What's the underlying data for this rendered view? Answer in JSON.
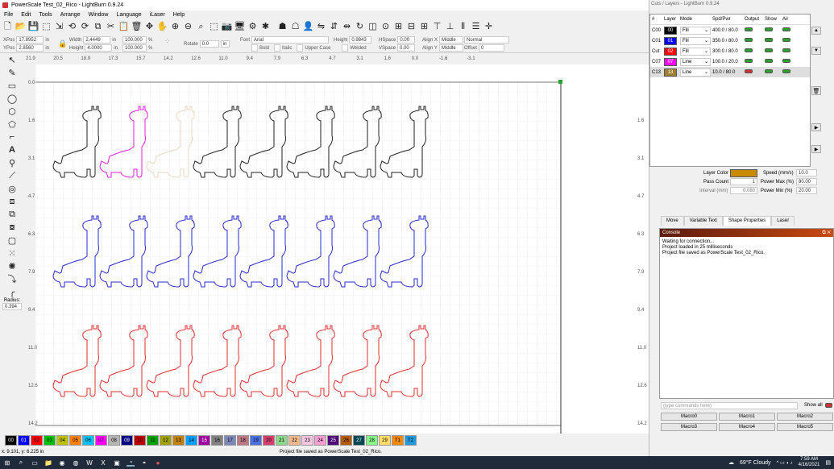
{
  "window": {
    "title": "PowerScale Test_02_Rico - LightBurn 0.9.24"
  },
  "menu": [
    "File",
    "Edit",
    "Tools",
    "Arrange",
    "Window",
    "Language",
    "iLaser",
    "Help"
  ],
  "props": {
    "xpos_label": "XPos",
    "xpos": "17.8952",
    "ypos_label": "YPos",
    "ypos": "2.8560",
    "unit": "in",
    "width_label": "Width",
    "width": "2.4449",
    "height_label": "Height",
    "height": "4.0000",
    "scale_w": "100.000",
    "scale_h": "100.000",
    "pct": "%",
    "rotate_label": "Rotate",
    "rotate": "0.0",
    "font_label": "Font",
    "font": "Arial",
    "fheight_label": "Height",
    "fheight": "0.9843",
    "hspace_label": "HSpace",
    "hspace": "0.00",
    "vspace_label": "VSpace",
    "vspace": "0.00",
    "alignx_label": "Align X",
    "alignx": "Middle",
    "aligny_label": "Align Y",
    "aligny": "Middle",
    "normal": "Normal",
    "offset_label": "Offset",
    "offset": "0",
    "bold": "Bold",
    "italic": "Italic",
    "upper": "Upper Case",
    "welded": "Welded"
  },
  "ruler_top": [
    "21.9",
    "20.5",
    "18.9",
    "17.3",
    "15.7",
    "14.2",
    "12.6",
    "11.0",
    "9.4",
    "7.9",
    "6.3",
    "4.7",
    "3.1",
    "1.6",
    "0.0",
    "-1.6",
    "-3.1"
  ],
  "ruler_left": [
    "0.0",
    "1.6",
    "3.1",
    "4.7",
    "6.3",
    "7.9",
    "9.4",
    "11.0",
    "12.6",
    "14.2"
  ],
  "ruler_right": [
    "1.6",
    "3.1",
    "4.7",
    "6.3",
    "7.9",
    "9.4",
    "11.0",
    "12.6",
    "14.2"
  ],
  "radius_label": "Radius:",
  "radius": "0.394",
  "palette": [
    {
      "id": "00",
      "color": "#000000",
      "text": "#ffffff"
    },
    {
      "id": "01",
      "color": "#0000ff",
      "text": "#ffffff"
    },
    {
      "id": "02",
      "color": "#ff0000",
      "text": "#000000"
    },
    {
      "id": "03",
      "color": "#00c000",
      "text": "#000000"
    },
    {
      "id": "04",
      "color": "#c0c000",
      "text": "#000000"
    },
    {
      "id": "05",
      "color": "#ff8000",
      "text": "#000000"
    },
    {
      "id": "06",
      "color": "#00c0ff",
      "text": "#000000"
    },
    {
      "id": "07",
      "color": "#ff00ff",
      "text": "#000000"
    },
    {
      "id": "08",
      "color": "#b4b4b4",
      "text": "#000000"
    },
    {
      "id": "09",
      "color": "#000080",
      "text": "#ffffff"
    },
    {
      "id": "10",
      "color": "#c00000",
      "text": "#000000"
    },
    {
      "id": "11",
      "color": "#00a000",
      "text": "#000000"
    },
    {
      "id": "12",
      "color": "#a0a000",
      "text": "#000000"
    },
    {
      "id": "13",
      "color": "#c08000",
      "text": "#000000"
    },
    {
      "id": "14",
      "color": "#00a0ff",
      "text": "#000000"
    },
    {
      "id": "15",
      "color": "#a000a0",
      "text": "#ffffff"
    },
    {
      "id": "16",
      "color": "#808080",
      "text": "#000000"
    },
    {
      "id": "17",
      "color": "#7d87b9",
      "text": "#000000"
    },
    {
      "id": "18",
      "color": "#bb7784",
      "text": "#000000"
    },
    {
      "id": "19",
      "color": "#4a6fe3",
      "text": "#000000"
    },
    {
      "id": "20",
      "color": "#d33f6a",
      "text": "#000000"
    },
    {
      "id": "21",
      "color": "#8cd78c",
      "text": "#000000"
    },
    {
      "id": "22",
      "color": "#f0b98d",
      "text": "#000000"
    },
    {
      "id": "23",
      "color": "#f6c4e1",
      "text": "#000000"
    },
    {
      "id": "24",
      "color": "#fa9ed4",
      "text": "#000000"
    },
    {
      "id": "25",
      "color": "#500a78",
      "text": "#ffffff"
    },
    {
      "id": "26",
      "color": "#b45a00",
      "text": "#000000"
    },
    {
      "id": "27",
      "color": "#004754",
      "text": "#ffffff"
    },
    {
      "id": "28",
      "color": "#86fa88",
      "text": "#000000"
    },
    {
      "id": "29",
      "color": "#ffdb66",
      "text": "#000000"
    },
    {
      "id": "T1",
      "color": "#f28a00",
      "text": "#000000"
    },
    {
      "id": "T2",
      "color": "#2299dd",
      "text": "#000000"
    }
  ],
  "status": {
    "coords": "x: 9.101, y: 6.225 in",
    "message": "Project file saved as PowerScale Test_02_Rico."
  },
  "layers": {
    "header": "Cuts / Layers - LightBurn 0.9.24",
    "cols": [
      "#",
      "Layer",
      "Mode",
      "Spd/Pwr",
      "Output",
      "Show",
      "Air"
    ],
    "rows": [
      {
        "num": "C00",
        "sw": "00",
        "color": "#000000",
        "text": "#ffffff",
        "mode": "Fill",
        "sp": "400.0 / 80.0",
        "out": true
      },
      {
        "num": "C01",
        "sw": "01",
        "color": "#0000ff",
        "text": "#ffffff",
        "mode": "Fill",
        "sp": "350.0 / 80.0",
        "out": true
      },
      {
        "num": "Cut",
        "sw": "02",
        "color": "#ff0000",
        "text": "#ffffff",
        "mode": "Fill",
        "sp": "300.0 / 80.0",
        "out": true
      },
      {
        "num": "C07",
        "sw": "07",
        "color": "#ff00ff",
        "text": "#ffffff",
        "mode": "Line",
        "sp": "100.0 / 20.0",
        "out": true
      },
      {
        "num": "C13",
        "sw": "13",
        "color": "#a08030",
        "text": "#ffffff",
        "mode": "Line",
        "sp": "10.0 / 80.0",
        "out": false
      }
    ]
  },
  "layerProps": {
    "layer_color": "Layer Color",
    "speed_label": "Speed (mm/s)",
    "speed": "10.0",
    "pass_label": "Pass Count",
    "pass": "1",
    "pmax_label": "Power Max (%)",
    "pmax": "80.00",
    "interval_label": "Interval (mm)",
    "interval": "0.080",
    "pmin_label": "Power Min (%)",
    "pmin": "20.00"
  },
  "tabs": [
    "Move",
    "Variable Text",
    "Shape Properties",
    "Laser"
  ],
  "console": {
    "title": "Console",
    "lines": [
      "Waiting for connection...",
      "Project loaded in 25 milliseconds",
      "Project file saved as PowerScale Test_02_Rico."
    ],
    "placeholder": "(type commands here)",
    "showall": "Show all"
  },
  "macros": [
    "Macro0",
    "Macro1",
    "Macro2",
    "Macro3",
    "Macro4",
    "Macro5"
  ],
  "taskbar": {
    "weather": "69°F Cloudy",
    "time": "7:59 AM",
    "date": "4/16/2021"
  }
}
